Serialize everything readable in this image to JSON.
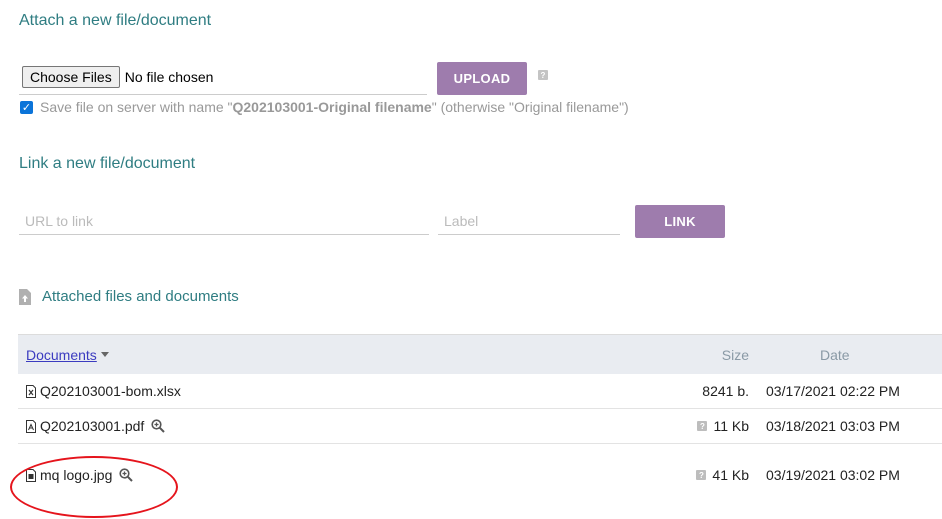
{
  "attach": {
    "title": "Attach a new file/document",
    "choose_files_label": "Choose Files",
    "no_file_text": "No file chosen",
    "upload_label": "UPLOAD",
    "help_glyph": "?",
    "checkbox_checked": true,
    "checkbox_text_prefix": "Save file on server with name \"",
    "checkbox_text_bold": "Q202103001-Original filename",
    "checkbox_text_suffix": "\" (otherwise \"Original filename\")"
  },
  "link": {
    "title": "Link a new file/document",
    "url_placeholder": "URL to link",
    "label_placeholder": "Label",
    "link_label": "LINK"
  },
  "attached": {
    "title": "Attached files and documents",
    "columns": {
      "documents": "Documents",
      "size": "Size",
      "date": "Date"
    },
    "rows": [
      {
        "name": "Q202103001-bom.xlsx",
        "icon": "excel-file-icon",
        "preview": false,
        "size_help": false,
        "size": "8241 b.",
        "date": "03/17/2021 02:22 PM"
      },
      {
        "name": "Q202103001.pdf",
        "icon": "pdf-file-icon",
        "preview": true,
        "size_help": true,
        "size": "11 Kb",
        "date": "03/18/2021 03:03 PM"
      },
      {
        "name": "mq logo.jpg",
        "icon": "image-file-icon",
        "preview": true,
        "size_help": true,
        "size": "41 Kb",
        "date": "03/19/2021 03:02 PM"
      }
    ]
  },
  "colors": {
    "accent_teal": "#2f7d82",
    "button_purple": "#9e7cad",
    "highlight_red": "#e5141c"
  }
}
